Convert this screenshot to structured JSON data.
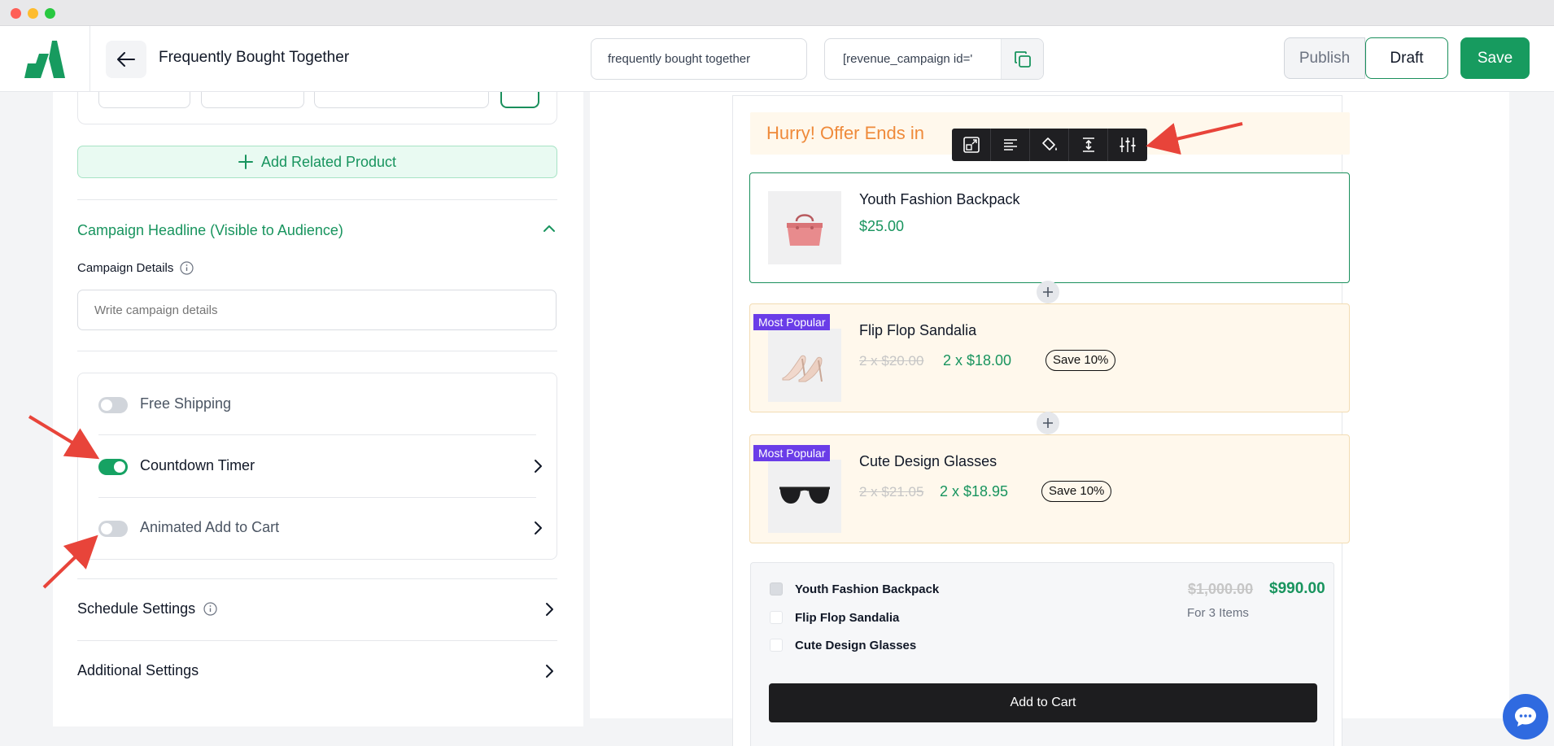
{
  "header": {
    "title": "Frequently Bought Together",
    "campaign_name": "frequently bought together",
    "shortcode": "[revenue_campaign id='",
    "publish_label": "Publish",
    "draft_label": "Draft",
    "save_label": "Save"
  },
  "sidebar": {
    "add_related_label": "Add Related Product",
    "headline_section_title": "Campaign Headline (Visible to Audience)",
    "campaign_details_label": "Campaign Details",
    "campaign_details_placeholder": "Write campaign details",
    "features": [
      {
        "label": "Free Shipping",
        "enabled": false,
        "has_chevron": false
      },
      {
        "label": "Countdown Timer",
        "enabled": true,
        "has_chevron": true
      },
      {
        "label": "Animated Add to Cart",
        "enabled": false,
        "has_chevron": true
      }
    ],
    "schedule_label": "Schedule Settings",
    "additional_label": "Additional Settings"
  },
  "preview": {
    "banner_text": "Hurry! Offer Ends in",
    "main_product": {
      "name": "Youth Fashion Backpack",
      "price": "$25.00"
    },
    "offers": [
      {
        "badge": "Most Popular",
        "name": "Flip Flop Sandalia",
        "old_price": "2 x $20.00",
        "new_price": "2 x $18.00",
        "save": "Save 10%"
      },
      {
        "badge": "Most Popular",
        "name": "Cute Design Glasses",
        "old_price": "2 x $21.05",
        "new_price": "2 x $18.95",
        "save": "Save 10%"
      }
    ],
    "summary": {
      "items": [
        {
          "name": "Youth Fashion Backpack",
          "checked": true
        },
        {
          "name": "Flip Flop Sandalia",
          "checked": false
        },
        {
          "name": "Cute Design Glasses",
          "checked": false
        }
      ],
      "old_total": "$1,000.00",
      "new_total": "$990.00",
      "items_count": "For 3 Items",
      "add_to_cart_label": "Add to Cart"
    }
  },
  "colors": {
    "brand_green": "#179b5f",
    "banner_orange": "#ef8a3a",
    "badge_purple": "#6a3de8",
    "annotation_red": "#e8443a"
  }
}
